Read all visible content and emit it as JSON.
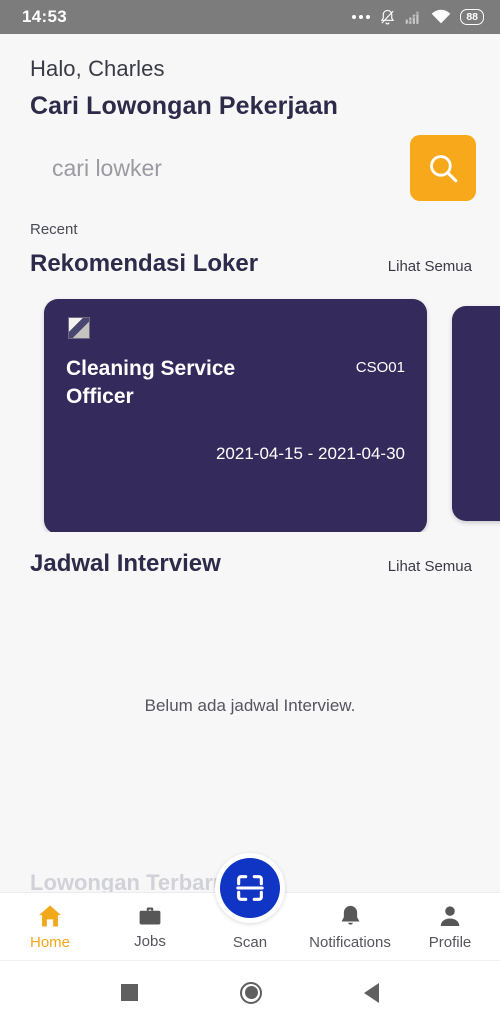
{
  "status_bar": {
    "time": "14:53",
    "battery_level": "88",
    "icons": [
      "more-dots-icon",
      "notifications-off-icon",
      "cellular-signal-off-icon",
      "wifi-icon",
      "battery-icon"
    ]
  },
  "header": {
    "greeting": "Halo, Charles",
    "title": "Cari Lowongan Pekerjaan",
    "search_placeholder": "cari lowker",
    "search_value": "",
    "search_button_label": "search-icon",
    "search_button_color": "#F7A81B"
  },
  "recent_label": "Recent",
  "sections": [
    {
      "title": "Rekomendasi Loker",
      "link": "Lihat Semua"
    },
    {
      "title": "Jadwal Interview",
      "link": "Lihat Semua",
      "empty_message": "Belum ada jadwal Interview."
    }
  ],
  "job_cards": [
    {
      "title": "Cleaning Service Officer",
      "code": "CSO01",
      "date_range": "2021-04-15 - 2021-04-30",
      "card_color": "#342B5C",
      "thumbnail": "broken-image-icon"
    }
  ],
  "clipped_heading": "Lowongan Terbaru",
  "bottom_nav": {
    "active": "Home",
    "items": [
      {
        "label": "Home",
        "icon": "home-icon"
      },
      {
        "label": "Jobs",
        "icon": "briefcase-icon"
      },
      {
        "label": "Scan",
        "icon": "qr-scan-icon"
      },
      {
        "label": "Notifications",
        "icon": "bell-icon"
      },
      {
        "label": "Profile",
        "icon": "person-icon"
      }
    ],
    "active_color": "#F2A81B",
    "fab_color": "#1034C4"
  },
  "system_nav": {
    "items": [
      {
        "name": "recents-button",
        "icon": "square-icon"
      },
      {
        "name": "home-button",
        "icon": "circle-icon"
      },
      {
        "name": "back-button",
        "icon": "triangle-left-icon"
      }
    ]
  }
}
